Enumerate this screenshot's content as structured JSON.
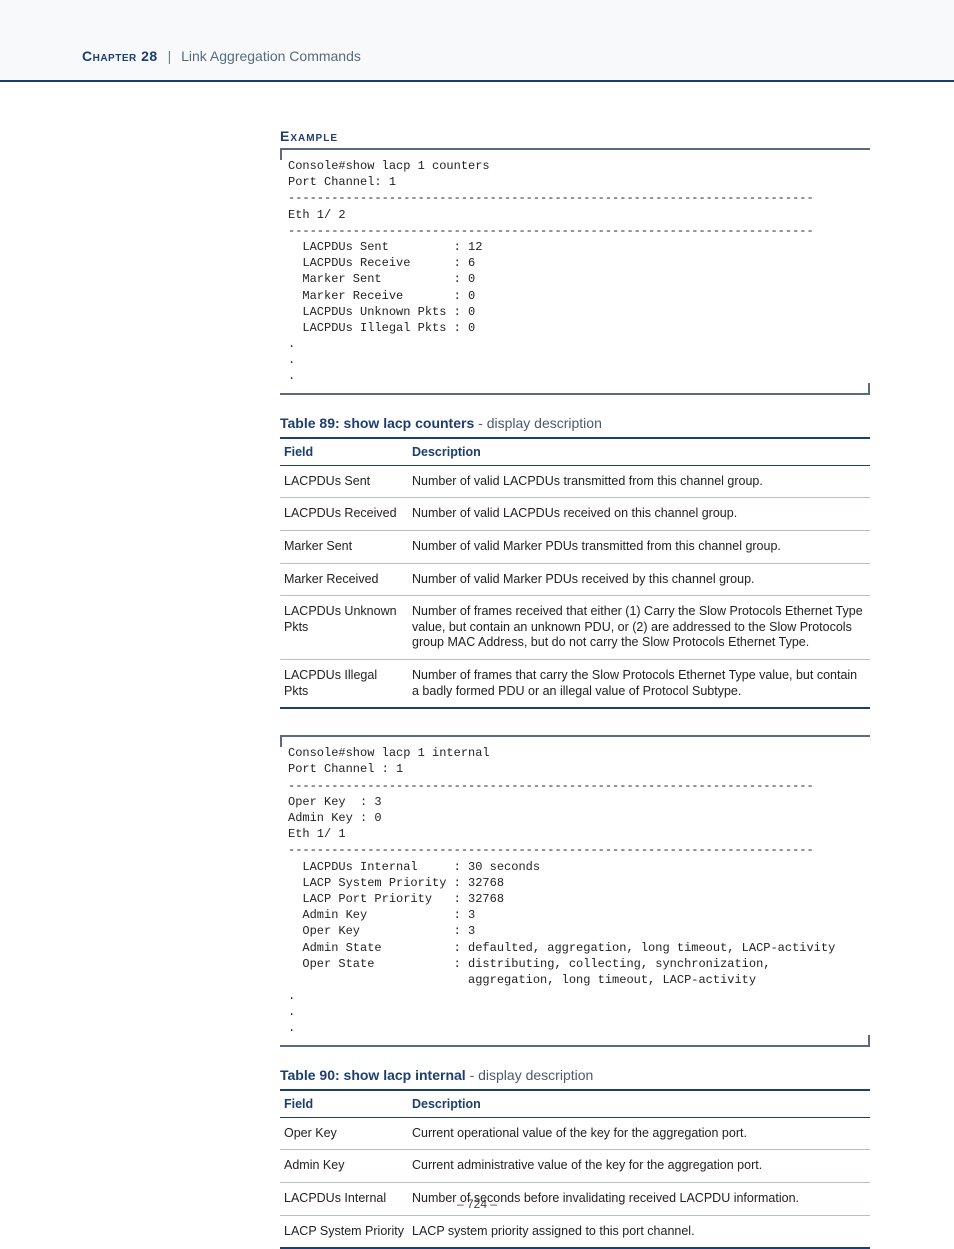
{
  "header": {
    "chapter": "Chapter 28",
    "separator": "|",
    "title": "Link Aggregation Commands"
  },
  "section_example": "Example",
  "code1": "Console#show lacp 1 counters\nPort Channel: 1\n-------------------------------------------------------------------------\nEth 1/ 2\n-------------------------------------------------------------------------\n  LACPDUs Sent         : 12\n  LACPDUs Receive      : 6\n  Marker Sent          : 0\n  Marker Receive       : 0\n  LACPDUs Unknown Pkts : 0\n  LACPDUs Illegal Pkts : 0\n.\n.\n.",
  "table89": {
    "title_bold": "Table 89: show lacp counters",
    "title_suffix": " - display description",
    "col_field": "Field",
    "col_desc": "Description",
    "rows": [
      {
        "f": "LACPDUs Sent",
        "d": "Number of valid LACPDUs transmitted from this channel group."
      },
      {
        "f": "LACPDUs Received",
        "d": "Number of valid LACPDUs received on this channel group."
      },
      {
        "f": "Marker Sent",
        "d": "Number of valid Marker PDUs transmitted from this channel group."
      },
      {
        "f": "Marker Received",
        "d": "Number of valid Marker PDUs received by this channel group."
      },
      {
        "f": "LACPDUs Unknown Pkts",
        "d": "Number of frames received that either (1) Carry the Slow Protocols Ethernet Type value, but contain an unknown PDU, or (2) are addressed to the Slow Protocols group MAC Address, but do not carry the Slow Protocols Ethernet Type."
      },
      {
        "f": "LACPDUs Illegal Pkts",
        "d": "Number of frames that carry the Slow Protocols Ethernet Type value, but contain a badly formed PDU or an illegal value of Protocol Subtype."
      }
    ]
  },
  "code2": "Console#show lacp 1 internal\nPort Channel : 1\n-------------------------------------------------------------------------\nOper Key  : 3\nAdmin Key : 0\nEth 1/ 1\n-------------------------------------------------------------------------\n  LACPDUs Internal     : 30 seconds\n  LACP System Priority : 32768\n  LACP Port Priority   : 32768\n  Admin Key            : 3\n  Oper Key             : 3\n  Admin State          : defaulted, aggregation, long timeout, LACP-activity\n  Oper State           : distributing, collecting, synchronization,\n                         aggregation, long timeout, LACP-activity\n.\n.\n.",
  "table90": {
    "title_bold": "Table 90: show lacp internal",
    "title_suffix": " - display description",
    "col_field": "Field",
    "col_desc": "Description",
    "rows": [
      {
        "f": "Oper Key",
        "d": "Current operational value of the key for the aggregation port."
      },
      {
        "f": "Admin Key",
        "d": "Current administrative value of the key for the aggregation port."
      },
      {
        "f": "LACPDUs Internal",
        "d": "Number of seconds before invalidating received LACPDU information."
      },
      {
        "f": "LACP System Priority",
        "d": "LACP system priority assigned to this port channel."
      }
    ]
  },
  "page_number": "– 724 –"
}
